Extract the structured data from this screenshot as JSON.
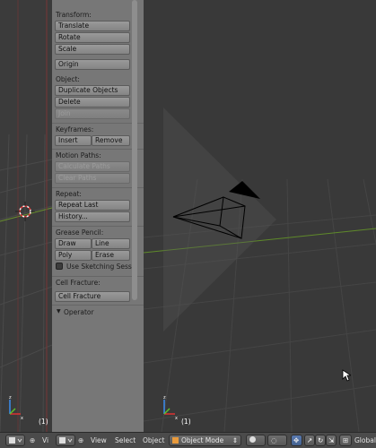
{
  "tool_shelf": {
    "transform": {
      "label": "Transform:",
      "translate": "Translate",
      "rotate": "Rotate",
      "scale": "Scale"
    },
    "origin": "Origin",
    "object": {
      "label": "Object:",
      "duplicate": "Duplicate Objects",
      "delete": "Delete",
      "join": "Join"
    },
    "keyframes": {
      "label": "Keyframes:",
      "insert": "Insert",
      "remove": "Remove"
    },
    "motion_paths": {
      "label": "Motion Paths:",
      "calculate": "Calculate Paths",
      "clear": "Clear Paths"
    },
    "repeat": {
      "label": "Repeat:",
      "repeat_last": "Repeat Last",
      "history": "History..."
    },
    "grease_pencil": {
      "label": "Grease Pencil:",
      "draw": "Draw",
      "line": "Line",
      "poly": "Poly",
      "erase": "Erase",
      "sketching": "Use Sketching Sessio"
    },
    "cell_fracture": {
      "label": "Cell Fracture:",
      "button": "Cell Fracture"
    },
    "operator": {
      "label": "Operator"
    }
  },
  "viewport": {
    "left_frame": "(1)",
    "main_frame": "(1)"
  },
  "header": {
    "left_view": "Vi",
    "view": "View",
    "select": "Select",
    "object": "Object",
    "mode": "Object Mode",
    "orientation": "Global"
  },
  "colors": {
    "shelf_bg": "#777777",
    "viewport_bg": "#393939",
    "header_bg": "#4b4b4b",
    "grid_x": "#6a8f2e",
    "grid_y": "#8a3a3a"
  }
}
